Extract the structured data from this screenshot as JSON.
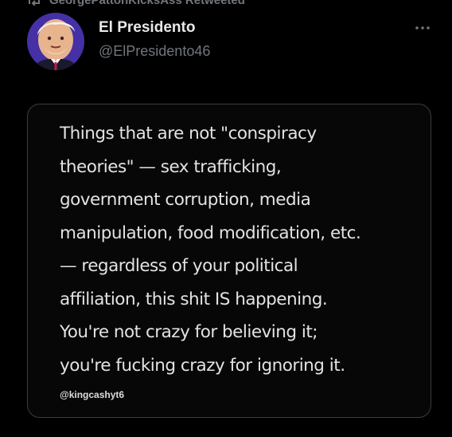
{
  "retweet": {
    "label": "GeorgePattonKicksAss Retweeted",
    "icon": "retweet-icon"
  },
  "author": {
    "display_name": "El Presidento",
    "handle": "@ElPresidento46",
    "avatar": "avatar"
  },
  "menu": {
    "icon": "more-options-icon"
  },
  "media": {
    "quote_lines": [
      "Things that are not \"conspiracy",
      "theories\" — sex trafficking,",
      "government corruption, media",
      "manipulation, food modification, etc.",
      "— regardless of your political",
      "affiliation, this shit IS happening.",
      "You're not crazy for believing it;",
      "you're fucking crazy for ignoring it."
    ],
    "watermark": "@kingcashyt6"
  },
  "colors": {
    "background": "#000000",
    "primary_text": "#e7e9ea",
    "secondary_text": "#71767b",
    "card_border": "#3a3d41"
  }
}
